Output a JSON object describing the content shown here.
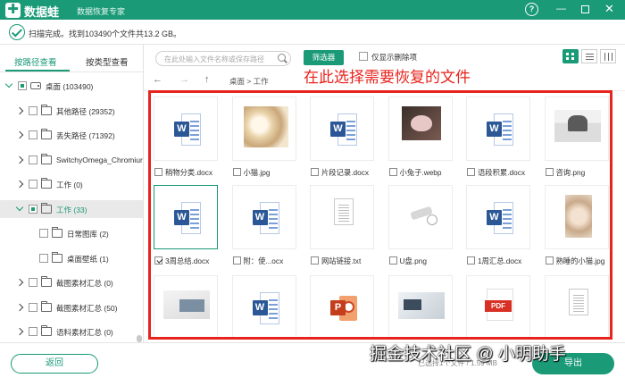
{
  "app": {
    "logo_glyph": "✚",
    "name": "数据蛙",
    "subtitle": "数据恢复专家",
    "brand_color": "#1a9a77"
  },
  "window_controls": {
    "help": "?",
    "minimize": "—",
    "close": "✕"
  },
  "scan": {
    "status": "扫描完成。找到103490个文件共13.2 GB。"
  },
  "sidebar": {
    "tabs": [
      {
        "label": "按路径查看",
        "active": true
      },
      {
        "label": "按类型查看",
        "active": false
      }
    ],
    "tree": [
      {
        "label": "桌面 (103490)",
        "icon": "drive-icon",
        "expander": "down",
        "check": "partial",
        "selected": false
      },
      {
        "label": "其他路径 (29352)",
        "icon": "folder-icon",
        "expander": "right",
        "check": "none",
        "selected": false
      },
      {
        "label": "丢失路径 (71392)",
        "icon": "folder-icon",
        "expander": "right",
        "check": "none",
        "selected": false
      },
      {
        "label": "SwitchyOmega_Chromiur",
        "icon": "folder-icon",
        "expander": "right",
        "check": "none",
        "selected": false
      },
      {
        "label": "工作 (0)",
        "icon": "folder-icon",
        "expander": "right",
        "check": "none",
        "selected": false
      },
      {
        "label": "工作 (33)",
        "icon": "folder-icon",
        "expander": "down",
        "check": "partial",
        "selected": true
      },
      {
        "label": "日常图库 (2)",
        "icon": "folder-icon",
        "expander": "none",
        "check": "none",
        "selected": false
      },
      {
        "label": "桌面壁纸 (1)",
        "icon": "folder-icon",
        "expander": "none",
        "check": "none",
        "selected": false
      },
      {
        "label": "截图素材汇总 (0)",
        "icon": "folder-icon",
        "expander": "right",
        "check": "none",
        "selected": false
      },
      {
        "label": "截图素材汇总 (50)",
        "icon": "folder-icon",
        "expander": "right",
        "check": "none",
        "selected": false
      },
      {
        "label": "语料素材汇总 (0)",
        "icon": "folder-icon",
        "expander": "right",
        "check": "none",
        "selected": false
      }
    ]
  },
  "toolbar": {
    "search_placeholder": "在此处输入文件名称或保存路径",
    "filter_label": "筛选器",
    "only_deleted_label": "仅显示删除项"
  },
  "nav": {
    "back": "←",
    "forward": "→",
    "up": "↑",
    "breadcrumb": "桌面 > 工作"
  },
  "annotation": {
    "text": "在此选择需要恢复的文件",
    "color": "#e8231d"
  },
  "files": [
    {
      "name": "稍物分类.docx",
      "kind": "word",
      "checked": false
    },
    {
      "name": "小猫.jpg",
      "kind": "p-cat1",
      "checked": false
    },
    {
      "name": "片段记录.docx",
      "kind": "word",
      "checked": false
    },
    {
      "name": "小兔子.webp",
      "kind": "p-rabbit",
      "checked": false
    },
    {
      "name": "语段积累.docx",
      "kind": "word",
      "checked": false
    },
    {
      "name": "咨询.png",
      "kind": "p-office",
      "checked": false
    },
    {
      "name": "3周总结.docx",
      "kind": "word",
      "checked": true
    },
    {
      "name": "附：使...ocx",
      "kind": "word",
      "checked": false
    },
    {
      "name": "网站链接.txt",
      "kind": "txt",
      "checked": false
    },
    {
      "name": "U盘.png",
      "kind": "p-usb",
      "checked": false
    },
    {
      "name": "1周汇总.docx",
      "kind": "word",
      "checked": false
    },
    {
      "name": "熟睡的小猫.jpg",
      "kind": "p-cat2",
      "checked": false
    },
    {
      "name": "",
      "kind": "p-laptop",
      "checked": false
    },
    {
      "name": "",
      "kind": "word",
      "checked": false
    },
    {
      "name": "",
      "kind": "ppt",
      "checked": false
    },
    {
      "name": "",
      "kind": "p-typing",
      "checked": false
    },
    {
      "name": "",
      "kind": "pdf",
      "checked": false
    },
    {
      "name": "",
      "kind": "txt",
      "checked": false
    }
  ],
  "icon_text": {
    "word": "W",
    "ppt": "P",
    "pdf": "PDF"
  },
  "footer": {
    "back_label": "返回",
    "info": "已选择1个文件 / 1.59 MB",
    "export_label": "导出"
  },
  "watermark": "掘金技术社区 @ 小明助手"
}
